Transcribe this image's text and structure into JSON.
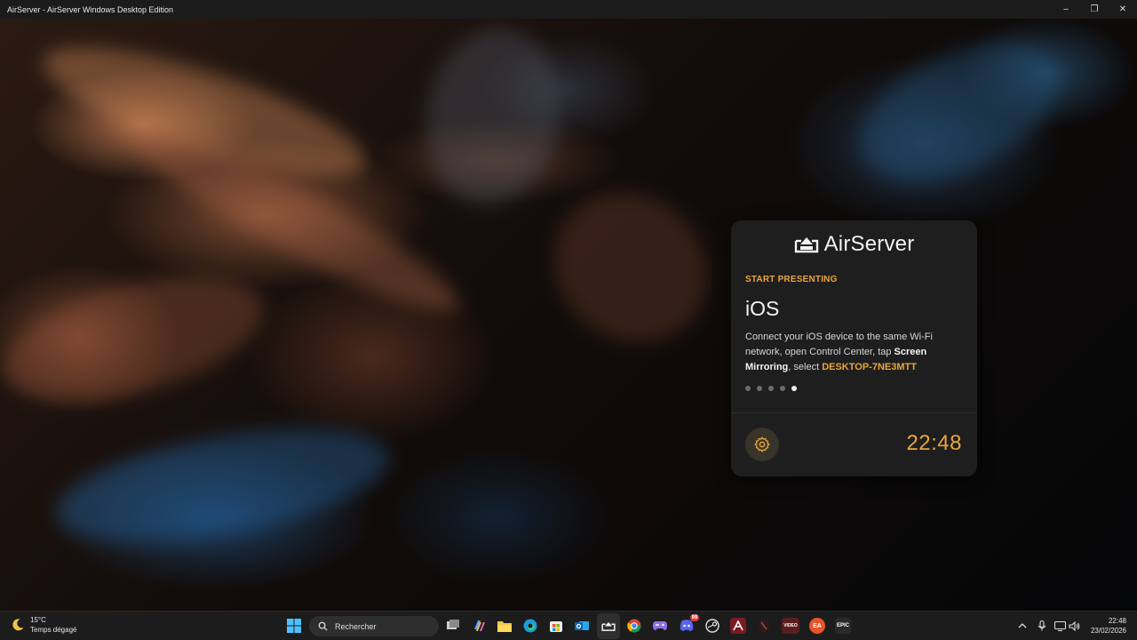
{
  "window": {
    "title": "AirServer - AirServer Windows Desktop Edition",
    "controls": {
      "minimize": "–",
      "maximize": "❐",
      "close": "✕"
    }
  },
  "card": {
    "logo_text": "AirServer",
    "section_label": "START PRESENTING",
    "platform": "iOS",
    "instructions": {
      "part1": "Connect your iOS device to the same Wi-Fi network, open Control Center, tap ",
      "bold": "Screen Mirroring",
      "part2": ", select ",
      "device": "DESKTOP-7NE3MTT"
    },
    "pager": {
      "total": 5,
      "active": 5
    },
    "clock": "22:48",
    "accent_color": "#e9a63c"
  },
  "taskbar": {
    "weather": {
      "temperature": "15°C",
      "condition": "Temps dégagé"
    },
    "search": {
      "placeholder": "Rechercher"
    },
    "apps": [
      {
        "name": "task-view",
        "badge": ""
      },
      {
        "name": "copilot",
        "badge": ""
      },
      {
        "name": "file-explorer",
        "badge": ""
      },
      {
        "name": "edge",
        "badge": ""
      },
      {
        "name": "microsoft-store",
        "badge": ""
      },
      {
        "name": "outlook",
        "badge": ""
      },
      {
        "name": "airserver",
        "badge": ""
      },
      {
        "name": "chrome",
        "badge": ""
      },
      {
        "name": "game-controller",
        "badge": ""
      },
      {
        "name": "discord",
        "badge": "99"
      },
      {
        "name": "steam",
        "badge": ""
      },
      {
        "name": "affinity",
        "badge": ""
      },
      {
        "name": "mask-app",
        "badge": ""
      },
      {
        "name": "video-app",
        "badge": ""
      },
      {
        "name": "ea-app",
        "badge": ""
      },
      {
        "name": "epic-games",
        "badge": ""
      }
    ],
    "video_app_label": "VIDEO",
    "epic_label": "EPIC",
    "ea_label": "EA",
    "clock_time": "22:48",
    "clock_date": "23/02/2026"
  }
}
